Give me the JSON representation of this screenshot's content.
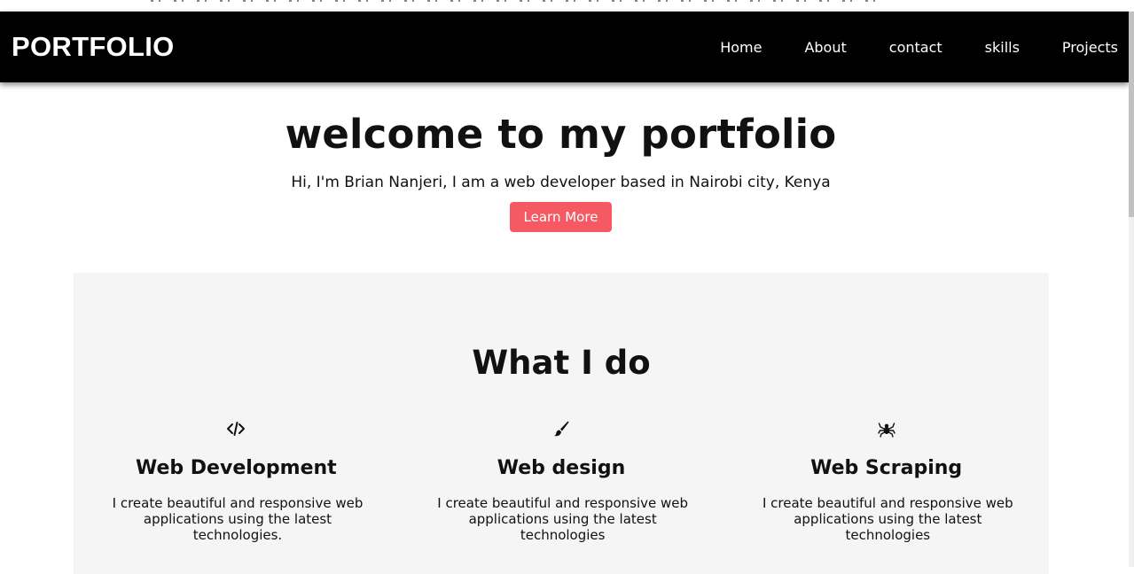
{
  "nav": {
    "brand": "PORTFOLIO",
    "links": [
      "Home",
      "About",
      "contact",
      "skills",
      "Projects"
    ]
  },
  "hero": {
    "title": "welcome to my portfolio",
    "subtitle": "Hi, I'm Brian Nanjeri, I am a web developer based in Nairobi city, Kenya",
    "button_label": "Learn More"
  },
  "services": {
    "title": "What I do",
    "items": [
      {
        "icon": "code-icon",
        "title": "Web Development",
        "description": "I create beautiful and responsive web applications using the latest technologies."
      },
      {
        "icon": "paintbrush-icon",
        "title": "Web design",
        "description": "I create beautiful and responsive web applications using the latest technologies"
      },
      {
        "icon": "spider-icon",
        "title": "Web Scraping",
        "description": "I create beautiful and responsive web applications using the latest technologies"
      }
    ]
  },
  "colors": {
    "navbar_bg": "#000000",
    "accent_button": "#f55a64",
    "section_bg": "#f5f5f5"
  }
}
